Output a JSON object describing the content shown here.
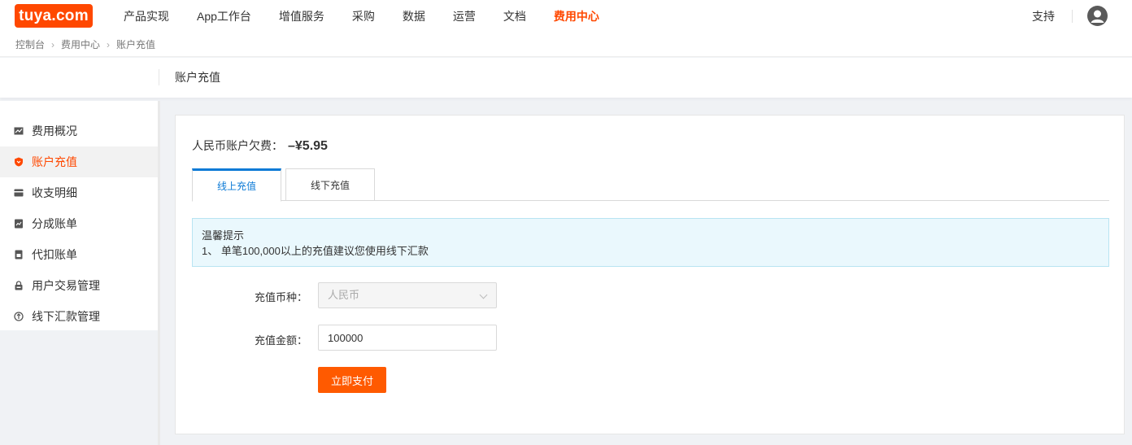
{
  "brand": {
    "logo_text": "tuya.com",
    "logo_color": "#ff4800"
  },
  "nav": {
    "items": [
      {
        "label": "产品实现"
      },
      {
        "label": "App工作台"
      },
      {
        "label": "增值服务"
      },
      {
        "label": "采购"
      },
      {
        "label": "数据"
      },
      {
        "label": "运营"
      },
      {
        "label": "文档"
      },
      {
        "label": "费用中心",
        "active": true
      }
    ],
    "support_label": "支持"
  },
  "breadcrumb": [
    "控制台",
    "费用中心",
    "账户充值"
  ],
  "page": {
    "title": "账户充值"
  },
  "sidebar": {
    "items": [
      {
        "label": "费用概况",
        "icon": "chart-icon"
      },
      {
        "label": "账户充值",
        "icon": "shield-icon",
        "active": true
      },
      {
        "label": "收支明细",
        "icon": "wallet-icon"
      },
      {
        "label": "分成账单",
        "icon": "bill-icon"
      },
      {
        "label": "代扣账单",
        "icon": "receipt-icon"
      },
      {
        "label": "用户交易管理",
        "icon": "lock-icon"
      },
      {
        "label": "线下汇款管理",
        "icon": "refresh-icon"
      }
    ]
  },
  "account": {
    "debt_label": "人民币账户欠费：",
    "debt_amount": "–¥5.95"
  },
  "tabs": [
    {
      "label": "线上充值",
      "active": true
    },
    {
      "label": "线下充值"
    }
  ],
  "notice": {
    "title": "温馨提示",
    "line1": "1、 单笔100,000以上的充值建议您使用线下汇款"
  },
  "form": {
    "currency_label": "充值币种：",
    "currency_value": "人民币",
    "amount_label": "充值金额：",
    "amount_value": "100000",
    "pay_button": "立即支付"
  },
  "colors": {
    "accent": "#ff4800",
    "tab_active": "#0c7ad6",
    "notice_bg": "#eaf8fd",
    "button": "#ff5a00"
  }
}
